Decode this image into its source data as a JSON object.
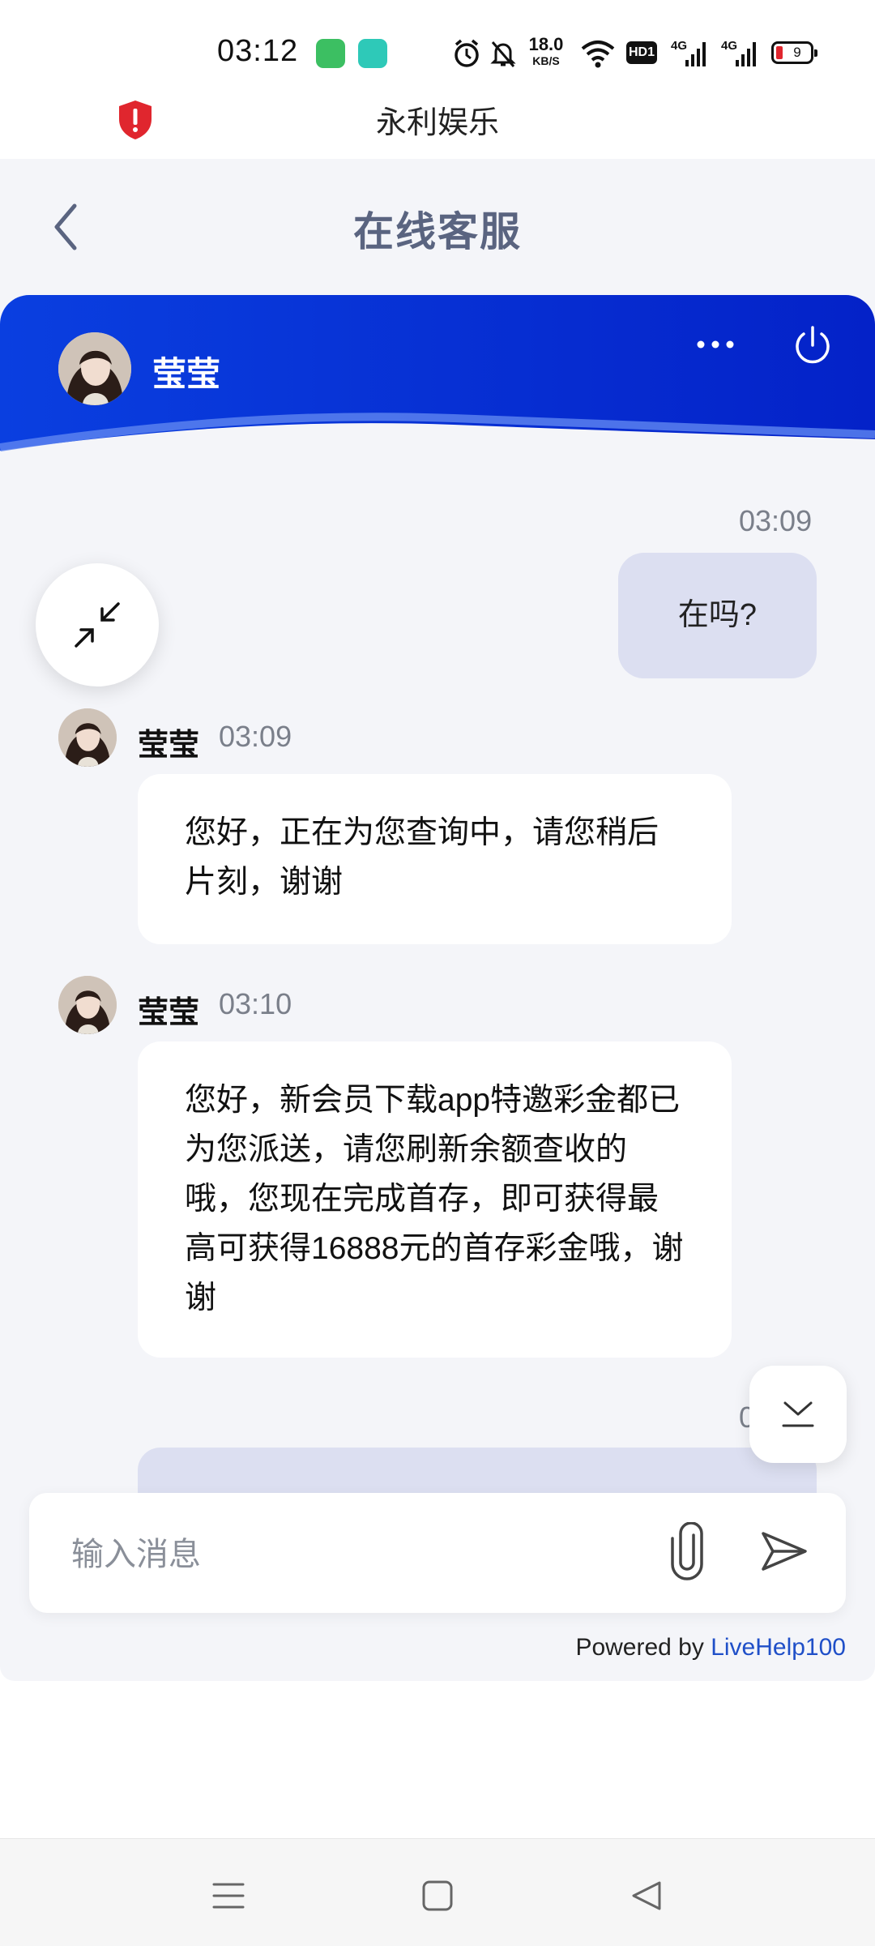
{
  "status_bar": {
    "time": "03:12",
    "net_speed_value": "18.0",
    "net_speed_unit": "KB/S",
    "hd_label": "HD1",
    "network1": "4G",
    "network2": "4G",
    "battery_level": "9",
    "icons": [
      "chat-app-icon",
      "message-app-icon",
      "alarm-icon",
      "mute-bell-icon",
      "wifi-icon",
      "signal-icon",
      "signal-icon",
      "battery-icon"
    ]
  },
  "site": {
    "title": "永利娱乐",
    "shield_color": "#e0262e"
  },
  "chat": {
    "title": "在线客服",
    "agent_name": "莹莹",
    "header_color": "#0a3fe0",
    "messages": [
      {
        "from": "user",
        "time": "03:09",
        "text": "在吗?"
      },
      {
        "from": "agent",
        "name": "莹莹",
        "time": "03:09",
        "text": "您好，正在为您查询中，请您稍后片刻，谢谢"
      },
      {
        "from": "agent",
        "name": "莹莹",
        "time": "03:10",
        "text": "您好，新会员下载app特邀彩金都已为您派送，请您刷新余额查收的哦，您现在完成首存，即可获得最高可获得16888元的首存彩金哦，谢谢"
      },
      {
        "from": "user",
        "time": "0",
        "text": ""
      }
    ],
    "input_placeholder": "输入消息",
    "powered_prefix": "Powered by ",
    "powered_link": "LiveHelp100"
  }
}
